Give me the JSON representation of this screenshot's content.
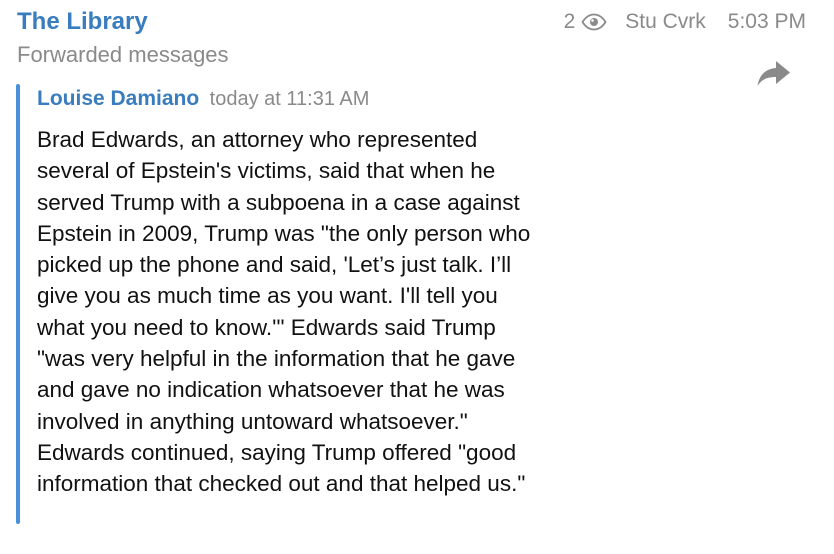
{
  "channel": {
    "title": "The Library",
    "views": "2",
    "views_icon": "eye-icon",
    "author_sign": "Stu Cvrk",
    "time": "5:03 PM",
    "forwarded_label": "Forwarded messages"
  },
  "share": {
    "icon": "share-arrow-icon",
    "color": "#8a8a8a"
  },
  "forwarded": {
    "author": "Louise Damiano",
    "date": "today at 11:31 AM",
    "bar_color": "#4a90d9"
  },
  "message": {
    "lines": [
      "Brad Edwards, an attorney who represented",
      "several of Epstein's victims, said that when he",
      "served Trump with a subpoena in a case against",
      "Epstein in 2009, Trump was \"the only person who",
      "picked up the phone and said, 'Let’s just talk. I’ll",
      "give you as much time as you want. I'll tell you",
      "what you need to know.'\" Edwards said Trump",
      "\"was very helpful in the information that he gave",
      "and gave no indication whatsoever that he was",
      "involved in anything untoward whatsoever.\"",
      "Edwards continued, saying Trump offered \"good",
      "information that checked out and that helped us.\""
    ]
  },
  "colors": {
    "accent": "#3a7dbf",
    "muted": "#8a8a8a",
    "text": "#111111"
  }
}
